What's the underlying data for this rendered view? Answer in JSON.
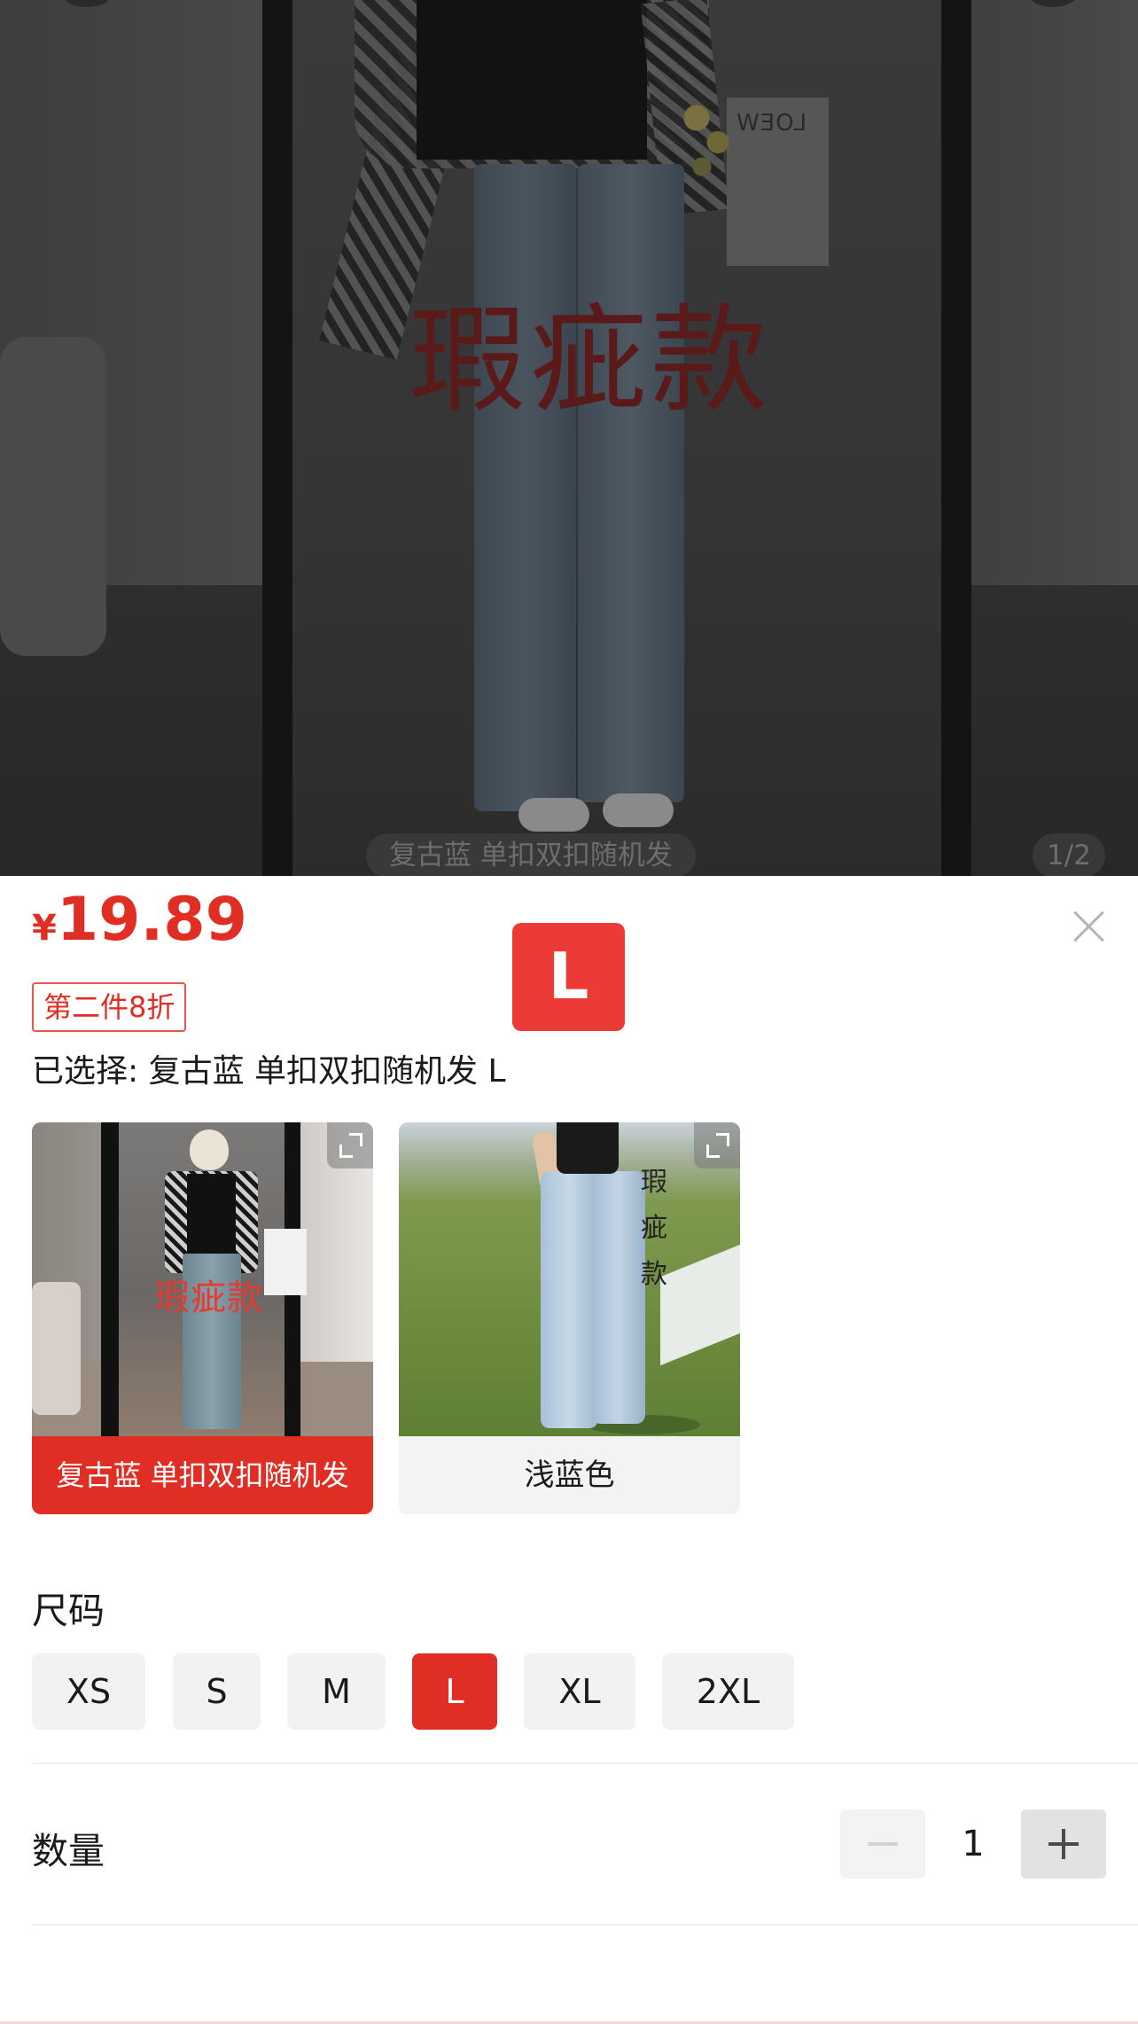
{
  "hero": {
    "watermark": "瑕疵款",
    "caption": "复古蓝 单扣双扣随机发",
    "pager": "1/2",
    "box_text": "LOEW"
  },
  "product": {
    "currency": "¥",
    "price": "19.89",
    "promo": "第二件8折",
    "selected_text": "已选择: 复古蓝 单扣双扣随机发 L",
    "size_badge": "L"
  },
  "colors": [
    {
      "label": "复古蓝 单扣双扣随机发",
      "watermark": "瑕疵款",
      "selected": true
    },
    {
      "label": "浅蓝色",
      "watermark": "瑕疵款",
      "selected": false
    }
  ],
  "size_section": {
    "title": "尺码",
    "options": [
      "XS",
      "S",
      "M",
      "L",
      "XL",
      "2XL"
    ],
    "selected": "L"
  },
  "quantity": {
    "title": "数量",
    "value": "1"
  },
  "accent_color": "#e02e24"
}
